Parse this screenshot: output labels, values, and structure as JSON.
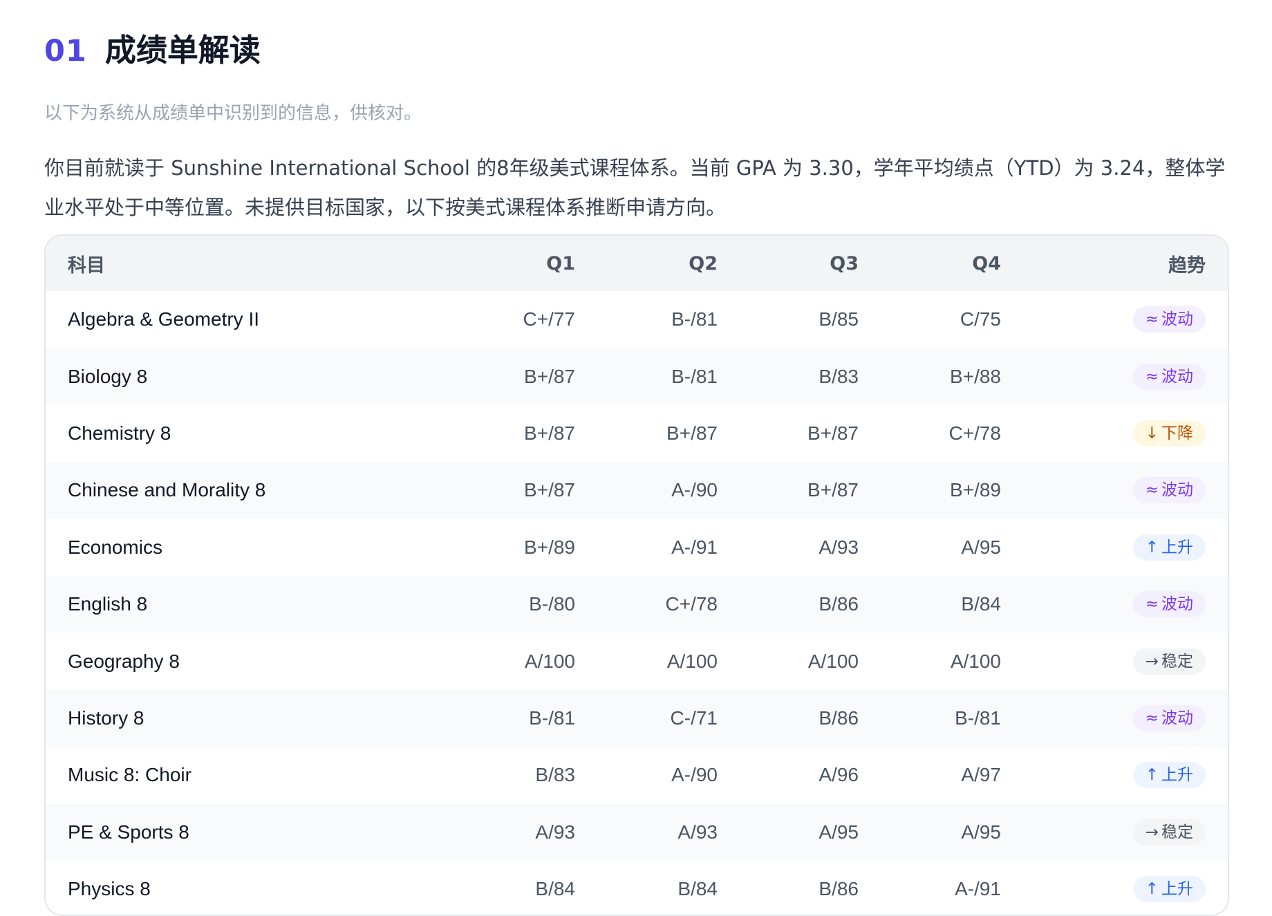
{
  "section": {
    "number": "01",
    "title": "成绩单解读"
  },
  "intro": {
    "hint": "以下为系统从成绩单中识别到的信息，供核对。",
    "text": "你目前就读于 Sunshine International School 的8年级美式课程体系。当前 GPA 为 3.30，学年平均绩点（YTD）为 3.24，整体学业水平处于中等位置。未提供目标国家，以下按美式课程体系推断申请方向。"
  },
  "table": {
    "headers": {
      "subject": "科目",
      "q1": "Q1",
      "q2": "Q2",
      "q3": "Q3",
      "q4": "Q4",
      "trend": "趋势"
    },
    "trend_styles": {
      "fluct": {
        "glyph": "≈",
        "icon": "approx-icon",
        "bg": "#f3efff",
        "fg": "#7c3aed"
      },
      "down": {
        "glyph": "↓",
        "icon": "arrow-down-icon",
        "bg": "#fff7e0",
        "fg": "#b45309"
      },
      "up": {
        "glyph": "↑",
        "icon": "arrow-up-icon",
        "bg": "#eef4ff",
        "fg": "#2563eb"
      },
      "flat": {
        "glyph": "→",
        "icon": "arrow-right-icon",
        "bg": "#f3f4f6",
        "fg": "#4b5563"
      }
    },
    "rows": [
      {
        "subject": "Algebra & Geometry II",
        "q1": "C+/77",
        "q2": "B-/81",
        "q3": "B/85",
        "q4": "C/75",
        "trend": "波动",
        "trend_type": "fluct"
      },
      {
        "subject": "Biology 8",
        "q1": "B+/87",
        "q2": "B-/81",
        "q3": "B/83",
        "q4": "B+/88",
        "trend": "波动",
        "trend_type": "fluct"
      },
      {
        "subject": "Chemistry 8",
        "q1": "B+/87",
        "q2": "B+/87",
        "q3": "B+/87",
        "q4": "C+/78",
        "trend": "下降",
        "trend_type": "down"
      },
      {
        "subject": "Chinese and Morality 8",
        "q1": "B+/87",
        "q2": "A-/90",
        "q3": "B+/87",
        "q4": "B+/89",
        "trend": "波动",
        "trend_type": "fluct"
      },
      {
        "subject": "Economics",
        "q1": "B+/89",
        "q2": "A-/91",
        "q3": "A/93",
        "q4": "A/95",
        "trend": "上升",
        "trend_type": "up"
      },
      {
        "subject": "English 8",
        "q1": "B-/80",
        "q2": "C+/78",
        "q3": "B/86",
        "q4": "B/84",
        "trend": "波动",
        "trend_type": "fluct"
      },
      {
        "subject": "Geography 8",
        "q1": "A/100",
        "q2": "A/100",
        "q3": "A/100",
        "q4": "A/100",
        "trend": "稳定",
        "trend_type": "flat"
      },
      {
        "subject": "History 8",
        "q1": "B-/81",
        "q2": "C-/71",
        "q3": "B/86",
        "q4": "B-/81",
        "trend": "波动",
        "trend_type": "fluct"
      },
      {
        "subject": "Music 8: Choir",
        "q1": "B/83",
        "q2": "A-/90",
        "q3": "A/96",
        "q4": "A/97",
        "trend": "上升",
        "trend_type": "up"
      },
      {
        "subject": "PE & Sports 8",
        "q1": "A/93",
        "q2": "A/93",
        "q3": "A/95",
        "q4": "A/95",
        "trend": "稳定",
        "trend_type": "flat"
      },
      {
        "subject": "Physics 8",
        "q1": "B/84",
        "q2": "B/84",
        "q3": "B/86",
        "q4": "A-/91",
        "trend": "上升",
        "trend_type": "up"
      }
    ]
  }
}
